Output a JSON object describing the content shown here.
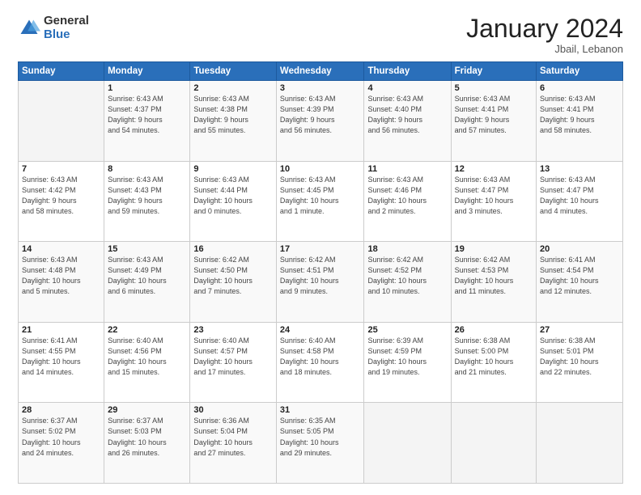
{
  "header": {
    "logo_general": "General",
    "logo_blue": "Blue",
    "month_year": "January 2024",
    "location": "Jbail, Lebanon"
  },
  "days_of_week": [
    "Sunday",
    "Monday",
    "Tuesday",
    "Wednesday",
    "Thursday",
    "Friday",
    "Saturday"
  ],
  "weeks": [
    [
      {
        "num": "",
        "detail": ""
      },
      {
        "num": "1",
        "detail": "Sunrise: 6:43 AM\nSunset: 4:37 PM\nDaylight: 9 hours\nand 54 minutes."
      },
      {
        "num": "2",
        "detail": "Sunrise: 6:43 AM\nSunset: 4:38 PM\nDaylight: 9 hours\nand 55 minutes."
      },
      {
        "num": "3",
        "detail": "Sunrise: 6:43 AM\nSunset: 4:39 PM\nDaylight: 9 hours\nand 56 minutes."
      },
      {
        "num": "4",
        "detail": "Sunrise: 6:43 AM\nSunset: 4:40 PM\nDaylight: 9 hours\nand 56 minutes."
      },
      {
        "num": "5",
        "detail": "Sunrise: 6:43 AM\nSunset: 4:41 PM\nDaylight: 9 hours\nand 57 minutes."
      },
      {
        "num": "6",
        "detail": "Sunrise: 6:43 AM\nSunset: 4:41 PM\nDaylight: 9 hours\nand 58 minutes."
      }
    ],
    [
      {
        "num": "7",
        "detail": "Sunrise: 6:43 AM\nSunset: 4:42 PM\nDaylight: 9 hours\nand 58 minutes."
      },
      {
        "num": "8",
        "detail": "Sunrise: 6:43 AM\nSunset: 4:43 PM\nDaylight: 9 hours\nand 59 minutes."
      },
      {
        "num": "9",
        "detail": "Sunrise: 6:43 AM\nSunset: 4:44 PM\nDaylight: 10 hours\nand 0 minutes."
      },
      {
        "num": "10",
        "detail": "Sunrise: 6:43 AM\nSunset: 4:45 PM\nDaylight: 10 hours\nand 1 minute."
      },
      {
        "num": "11",
        "detail": "Sunrise: 6:43 AM\nSunset: 4:46 PM\nDaylight: 10 hours\nand 2 minutes."
      },
      {
        "num": "12",
        "detail": "Sunrise: 6:43 AM\nSunset: 4:47 PM\nDaylight: 10 hours\nand 3 minutes."
      },
      {
        "num": "13",
        "detail": "Sunrise: 6:43 AM\nSunset: 4:47 PM\nDaylight: 10 hours\nand 4 minutes."
      }
    ],
    [
      {
        "num": "14",
        "detail": "Sunrise: 6:43 AM\nSunset: 4:48 PM\nDaylight: 10 hours\nand 5 minutes."
      },
      {
        "num": "15",
        "detail": "Sunrise: 6:43 AM\nSunset: 4:49 PM\nDaylight: 10 hours\nand 6 minutes."
      },
      {
        "num": "16",
        "detail": "Sunrise: 6:42 AM\nSunset: 4:50 PM\nDaylight: 10 hours\nand 7 minutes."
      },
      {
        "num": "17",
        "detail": "Sunrise: 6:42 AM\nSunset: 4:51 PM\nDaylight: 10 hours\nand 9 minutes."
      },
      {
        "num": "18",
        "detail": "Sunrise: 6:42 AM\nSunset: 4:52 PM\nDaylight: 10 hours\nand 10 minutes."
      },
      {
        "num": "19",
        "detail": "Sunrise: 6:42 AM\nSunset: 4:53 PM\nDaylight: 10 hours\nand 11 minutes."
      },
      {
        "num": "20",
        "detail": "Sunrise: 6:41 AM\nSunset: 4:54 PM\nDaylight: 10 hours\nand 12 minutes."
      }
    ],
    [
      {
        "num": "21",
        "detail": "Sunrise: 6:41 AM\nSunset: 4:55 PM\nDaylight: 10 hours\nand 14 minutes."
      },
      {
        "num": "22",
        "detail": "Sunrise: 6:40 AM\nSunset: 4:56 PM\nDaylight: 10 hours\nand 15 minutes."
      },
      {
        "num": "23",
        "detail": "Sunrise: 6:40 AM\nSunset: 4:57 PM\nDaylight: 10 hours\nand 17 minutes."
      },
      {
        "num": "24",
        "detail": "Sunrise: 6:40 AM\nSunset: 4:58 PM\nDaylight: 10 hours\nand 18 minutes."
      },
      {
        "num": "25",
        "detail": "Sunrise: 6:39 AM\nSunset: 4:59 PM\nDaylight: 10 hours\nand 19 minutes."
      },
      {
        "num": "26",
        "detail": "Sunrise: 6:38 AM\nSunset: 5:00 PM\nDaylight: 10 hours\nand 21 minutes."
      },
      {
        "num": "27",
        "detail": "Sunrise: 6:38 AM\nSunset: 5:01 PM\nDaylight: 10 hours\nand 22 minutes."
      }
    ],
    [
      {
        "num": "28",
        "detail": "Sunrise: 6:37 AM\nSunset: 5:02 PM\nDaylight: 10 hours\nand 24 minutes."
      },
      {
        "num": "29",
        "detail": "Sunrise: 6:37 AM\nSunset: 5:03 PM\nDaylight: 10 hours\nand 26 minutes."
      },
      {
        "num": "30",
        "detail": "Sunrise: 6:36 AM\nSunset: 5:04 PM\nDaylight: 10 hours\nand 27 minutes."
      },
      {
        "num": "31",
        "detail": "Sunrise: 6:35 AM\nSunset: 5:05 PM\nDaylight: 10 hours\nand 29 minutes."
      },
      {
        "num": "",
        "detail": ""
      },
      {
        "num": "",
        "detail": ""
      },
      {
        "num": "",
        "detail": ""
      }
    ]
  ]
}
